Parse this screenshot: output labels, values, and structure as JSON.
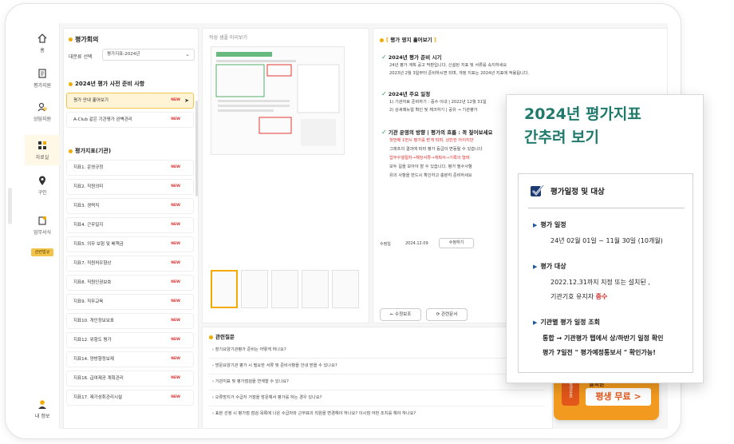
{
  "nav": {
    "items": [
      {
        "label": "홈",
        "icon": "home-icon"
      },
      {
        "label": "평가지원",
        "icon": "document-icon"
      },
      {
        "label": "상담지원",
        "icon": "person-search-icon"
      },
      {
        "label": "자료실",
        "icon": "archive-icon"
      },
      {
        "label": "구인",
        "icon": "location-pin-icon"
      },
      {
        "label": "업무서식",
        "icon": "form-icon"
      }
    ],
    "badge": "관련법규",
    "profile": "내 정보"
  },
  "list_panel": {
    "title": "평가회의",
    "filter_label": "대분류 선택",
    "filter_value": "평가지표-2024년",
    "section1": "2024년 평가 사전 준비 사항",
    "section1_items": [
      {
        "label": "평가 안내 훑어보기",
        "badge": "NEW",
        "active": true
      },
      {
        "label": "A-Club 같은 기관평가 완벽관리",
        "badge": "NEW",
        "active": false
      }
    ],
    "section2": "평가지표(기관)",
    "section2_items": [
      {
        "label": "지표1. 운영규정",
        "badge": "NEW"
      },
      {
        "label": "지표2. 직원의미",
        "badge": "NEW"
      },
      {
        "label": "지표3. 경력직",
        "badge": "NEW"
      },
      {
        "label": "지표4. 근무일지",
        "badge": "NEW"
      },
      {
        "label": "지표5. 의무 보험 및 배책금",
        "badge": "NEW"
      },
      {
        "label": "지표7. 직원처우향상",
        "badge": "NEW"
      },
      {
        "label": "지표8. 직원인권보호",
        "badge": "NEW"
      },
      {
        "label": "지표9. 직무교육",
        "badge": "NEW"
      },
      {
        "label": "지표10. 개인정보보호",
        "badge": "NEW"
      },
      {
        "label": "지표12. 위험도 평가",
        "badge": "NEW"
      },
      {
        "label": "지표14. 양방향정보제",
        "badge": "NEW"
      },
      {
        "label": "지표16. 급여제공 계획관리",
        "badge": "NEW"
      },
      {
        "label": "지표17. 제가성취관리시설",
        "badge": "NEW"
      }
    ]
  },
  "preview": {
    "title": "작성 샘플 미리보기"
  },
  "info_panel": {
    "title_bracket_open": "[",
    "title": "평가 영지 훑어보기",
    "title_bracket_close": "]",
    "blocks": [
      {
        "heading": "2024년 평가 준비 시기",
        "lines": [
          "24년 평가 계획 공고 막판입니다. 신설된 지표 및 서류를 숙지하세요",
          "2023년 2월 3일부터 준비하시면 되며, 개정 지표는 2024년 지표에 적용됩니다."
        ]
      },
      {
        "heading": "2024년 주요 일정",
        "lines": [
          "1) 기관자료 준비하기 : 중수 이내 | 2022년 12월 31일",
          "2) 상세매뉴얼 확인 및 체크하기 | 공유 → 기관평가"
        ]
      },
      {
        "heading": "기관 운영의 방향 | 평가의 흐름 : 꼭 짚어보세요",
        "lines": [
          "첫번째 1번시 평가를 받게 되며, 상반한 아이지만",
          "그래프의 결과에 따라 평가 등급이 변동될 수 있습니다",
          "업무수행절차→해당서류→계획서→기록의 형태",
          "모두 길을 모아야 할 수 있습니다. 평가 필수사항",
          "유의 사항을 반드시 확인하고 충분히 준비하세요"
        ]
      }
    ],
    "meta_label": "수정일",
    "meta_value": "2024.12.09",
    "meta_button": "수정하기",
    "prev_button": "수정보조",
    "next_button": "관련문서"
  },
  "related": {
    "title": "관련질문",
    "items": [
      "장기요양기관평가 준비는 어떻게 하나요?",
      "방문요양기관 평가 시 필요한 서류 및 준비사항을 안내 받을 수 있나요?",
      "기관지표 및 평가점검을 연계할 수 있나요?",
      "오류방지가 수급자 거점을 방문해서 평가를 하는 경우 있나요?",
      "표본 선정 시 평가점 점검 목록에 나온 수급자와 근무표의 직원을 변경해야 하나요? 이시점 어떤 조치를 해야 하나요?"
    ]
  },
  "promo": {
    "badge": "평생무료",
    "small": "월회원",
    "big": "평생 무료 >"
  },
  "overlay": {
    "title_line1": "2024년 평가지표",
    "title_line2": "간추려 보기",
    "box_heading": "평가일정 및 대상",
    "sections": [
      {
        "label": "평가 일정",
        "lines": [
          "24년 02월 01일 ~ 11월 30일 (10개월)"
        ]
      },
      {
        "label": "평가 대상",
        "lines": [
          "2022.12.31까지 지정 또는 설치된 ,",
          "기관기호 유지자"
        ],
        "red_suffix": "중수"
      },
      {
        "label": "기관별 평가 일정 조회",
        "lines": [
          "통합 → 기관평가 탭에서 상/하반기 일정 확인",
          "평가 7일전 \" 평가예정통보서 \" 확인가능!"
        ]
      }
    ]
  },
  "colors": {
    "accent": "#f2a900",
    "overlay_title": "#1f7a6c",
    "promo": "#f29a1f",
    "check_green": "#2a9d48",
    "new_badge": "#dd3333"
  }
}
